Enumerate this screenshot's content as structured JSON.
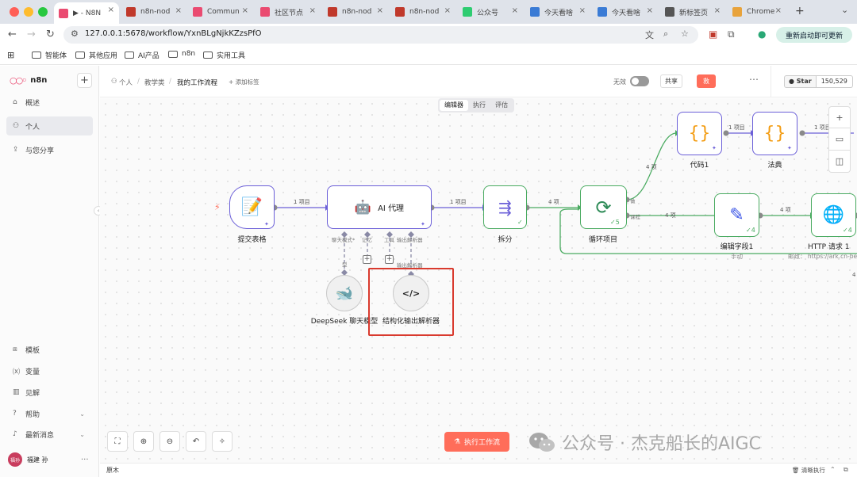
{
  "browser": {
    "tabs": [
      {
        "label": "▶ - N8N",
        "color": "#ea4b71",
        "active": true
      },
      {
        "label": "n8n-nod",
        "color": "#c0392b"
      },
      {
        "label": "Commun",
        "color": "#ea4b71"
      },
      {
        "label": "社区节点",
        "color": "#ea4b71"
      },
      {
        "label": "n8n-nod",
        "color": "#c0392b"
      },
      {
        "label": "n8n-nod",
        "color": "#c0392b"
      },
      {
        "label": "公众号",
        "color": "#2ecc71"
      },
      {
        "label": "今天看啥",
        "color": "#3a7bd5"
      },
      {
        "label": "今天看啥",
        "color": "#3a7bd5"
      },
      {
        "label": "新标签页",
        "color": "#555555"
      },
      {
        "label": "Chrome",
        "color": "#e8a33c"
      }
    ],
    "url": "127.0.0.1:5678/workflow/YxnBLgNjkKZzsPfO",
    "update_label": "重新启动即可更新",
    "bookmarks": [
      "智能体",
      "其他应用",
      "AI产品",
      "n8n",
      "实用工具"
    ]
  },
  "sidebar": {
    "brand": "n8n",
    "items": [
      {
        "label": "概述",
        "icon": "home-icon"
      },
      {
        "label": "个人",
        "icon": "user-icon"
      },
      {
        "label": "与您分享",
        "icon": "share-icon"
      }
    ],
    "bottom_items": [
      {
        "label": "模板",
        "icon": "template-icon"
      },
      {
        "label": "变量",
        "icon": "variable-icon"
      },
      {
        "label": "见解",
        "icon": "chart-icon"
      },
      {
        "label": "帮助",
        "icon": "help-icon"
      },
      {
        "label": "最新消息",
        "icon": "bell-icon"
      }
    ],
    "user_name": "福建 孙",
    "user_initials": "福孙"
  },
  "header": {
    "crumb_1": "个人",
    "crumb_2": "教学类",
    "crumb_3": "我的工作流程",
    "add_tag": "+ 添加标签",
    "inactive_label": "无效",
    "share_label": "共享",
    "save_label": "救",
    "github_star": "Star",
    "github_count": "150,529"
  },
  "canvas": {
    "tabs": [
      "编辑器",
      "执行",
      "评估"
    ],
    "nodes": {
      "form": "提交表格",
      "agent": "AI 代理",
      "split": "拆分",
      "loop": "循环项目",
      "code": "代码1",
      "rule": "法典",
      "edit": "编辑字段1",
      "edit_sub": "手动",
      "http": "HTTP 请求 1",
      "http_sub": "邮政： https://ark.cn-beij",
      "deepseek": "DeepSeek 聊天模型",
      "parser": "结构化输出解析器"
    },
    "ports": {
      "chat_model": "聊天模式*",
      "memory": "记忆",
      "tool": "工具",
      "parser": "输出解析器",
      "parser_under": "输出解析器",
      "model_under": "型",
      "loop_done": "做",
      "loop_loop": "课程"
    },
    "wire_labels": {
      "form_agent": "1 项目",
      "agent_split": "1 项目",
      "split_loop": "4 项",
      "loop_code": "4 项",
      "loop_edit": "4 项",
      "edit_http": "4 项",
      "code_rule": "1 项目",
      "rule_next": "1 项目",
      "return": "4"
    },
    "counts": {
      "loop": "5",
      "edit": "4",
      "http": "4"
    },
    "run_button": "执行工作流",
    "watermark": "公众号 · 杰克船长的AIGC"
  },
  "footer": {
    "left": "原木",
    "right": "清晰执行"
  },
  "colors": {
    "brand": "#ea4b71",
    "accent": "#ff6d5a",
    "success": "#4aab61",
    "trigger": "#6b5fd8",
    "highlight": "#d93a2e"
  }
}
